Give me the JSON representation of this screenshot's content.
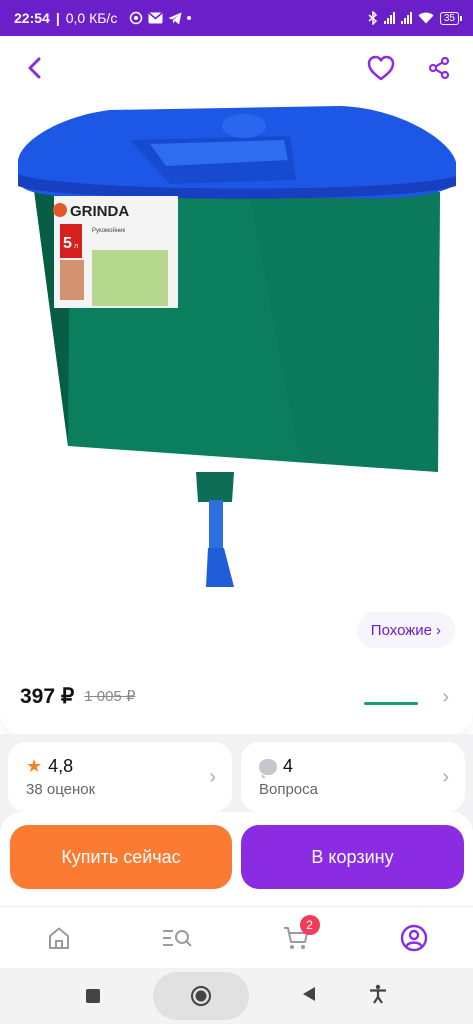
{
  "status_bar": {
    "time": "22:54",
    "speed": "0,0 КБ/с",
    "battery": "35"
  },
  "product": {
    "brand_label": "GRINDA",
    "product_label": "Рукомойник",
    "volume_label": "5",
    "volume_unit": "л"
  },
  "similar": {
    "label": "Похожие"
  },
  "price": {
    "current": "397 ₽",
    "old": "1 005 ₽"
  },
  "rating": {
    "value": "4,8",
    "count_label": "38 оценок"
  },
  "questions": {
    "count": "4",
    "label": "Вопроса"
  },
  "actions": {
    "buy_now": "Купить сейчас",
    "add_to_cart": "В корзину"
  },
  "bottom_nav": {
    "cart_badge": "2",
    "items": [
      "home-icon",
      "catalog-search-icon",
      "cart-icon",
      "profile-icon"
    ]
  },
  "colors": {
    "accent": "#8b2be2",
    "status_bar": "#6b1fc8",
    "buy": "#fb7b32",
    "badge": "#f03c5a"
  }
}
